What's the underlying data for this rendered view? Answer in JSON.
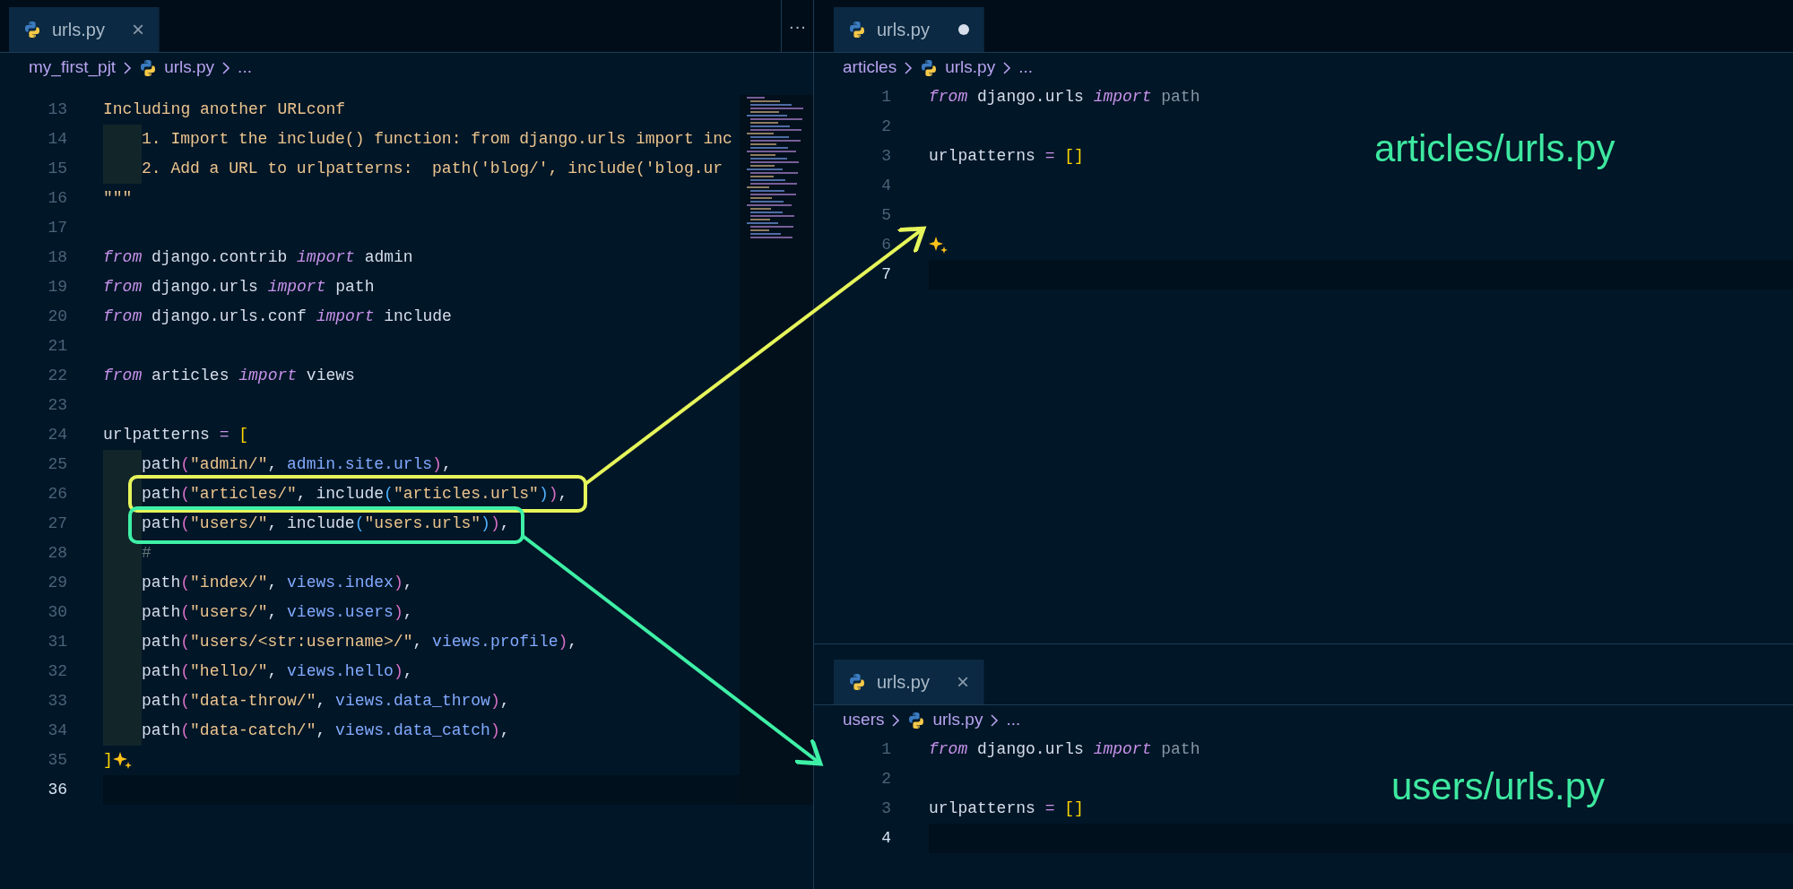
{
  "left_editor": {
    "tab": {
      "label": "urls.py",
      "close": "×",
      "modified": false,
      "selected": true
    },
    "more_button": "···",
    "breadcrumb": [
      "my_first_pjt",
      "urls.py",
      "..."
    ],
    "lines": [
      {
        "number": "13",
        "tokens": [
          {
            "kind": "docstring",
            "text": "Including another URLconf"
          }
        ]
      },
      {
        "number": "14",
        "indented": true,
        "tokens": [
          {
            "kind": "docstring",
            "text": "1. Import the include() function: from django.urls import inc"
          }
        ]
      },
      {
        "number": "15",
        "indented": true,
        "tokens": [
          {
            "kind": "docstring",
            "text": "2. Add a URL to urlpatterns:  path('blog/', include('blog.ur"
          }
        ]
      },
      {
        "number": "16",
        "tokens": [
          {
            "kind": "docstring",
            "text": "\"\"\""
          }
        ]
      },
      {
        "number": "17"
      },
      {
        "number": "18",
        "tokens": [
          {
            "kind": "keyword",
            "text": "from"
          },
          {
            "kind": "plain",
            "text": " django.contrib "
          },
          {
            "kind": "keyword",
            "text": "import"
          },
          {
            "kind": "plain",
            "text": " admin"
          }
        ]
      },
      {
        "number": "19",
        "tokens": [
          {
            "kind": "keyword",
            "text": "from"
          },
          {
            "kind": "plain",
            "text": " django.urls "
          },
          {
            "kind": "keyword",
            "text": "import"
          },
          {
            "kind": "plain",
            "text": " path"
          }
        ]
      },
      {
        "number": "20",
        "tokens": [
          {
            "kind": "keyword",
            "text": "from"
          },
          {
            "kind": "plain",
            "text": " django.urls.conf "
          },
          {
            "kind": "keyword",
            "text": "import"
          },
          {
            "kind": "plain",
            "text": " include"
          }
        ]
      },
      {
        "number": "21"
      },
      {
        "number": "22",
        "tokens": [
          {
            "kind": "keyword",
            "text": "from"
          },
          {
            "kind": "plain",
            "text": " articles "
          },
          {
            "kind": "keyword",
            "text": "import"
          },
          {
            "kind": "plain",
            "text": " views"
          }
        ]
      },
      {
        "number": "23"
      },
      {
        "number": "24",
        "tokens": [
          {
            "kind": "plain",
            "text": "urlpatterns "
          },
          {
            "kind": "operator",
            "text": "="
          },
          {
            "kind": "bracket",
            "text": " ["
          }
        ]
      },
      {
        "number": "25",
        "indented": true,
        "tokens": [
          {
            "kind": "plain",
            "text": "path"
          },
          {
            "kind": "paren",
            "text": "("
          },
          {
            "kind": "string",
            "text": "\"admin/\""
          },
          {
            "kind": "plain",
            "text": ", "
          },
          {
            "kind": "member",
            "text": "admin.site.urls"
          },
          {
            "kind": "paren",
            "text": ")"
          },
          {
            "kind": "plain",
            "text": ","
          }
        ]
      },
      {
        "number": "26",
        "indented": true,
        "tokens": [
          {
            "kind": "plain",
            "text": "path"
          },
          {
            "kind": "paren",
            "text": "("
          },
          {
            "kind": "string",
            "text": "\"articles/\""
          },
          {
            "kind": "plain",
            "text": ", include"
          },
          {
            "kind": "inner_paren",
            "text": "("
          },
          {
            "kind": "string",
            "text": "\"articles.urls\""
          },
          {
            "kind": "inner_paren",
            "text": ")"
          },
          {
            "kind": "paren",
            "text": ")"
          },
          {
            "kind": "plain",
            "text": ","
          }
        ]
      },
      {
        "number": "27",
        "indented": true,
        "tokens": [
          {
            "kind": "plain",
            "text": "path"
          },
          {
            "kind": "paren",
            "text": "("
          },
          {
            "kind": "string",
            "text": "\"users/\""
          },
          {
            "kind": "plain",
            "text": ", include"
          },
          {
            "kind": "inner_paren",
            "text": "("
          },
          {
            "kind": "string",
            "text": "\"users.urls\""
          },
          {
            "kind": "inner_paren",
            "text": ")"
          },
          {
            "kind": "paren",
            "text": ")"
          },
          {
            "kind": "plain",
            "text": ","
          }
        ]
      },
      {
        "number": "28",
        "indented": true,
        "tokens": [
          {
            "kind": "comment",
            "text": "#"
          }
        ]
      },
      {
        "number": "29",
        "indented": true,
        "tokens": [
          {
            "kind": "plain",
            "text": "path"
          },
          {
            "kind": "paren",
            "text": "("
          },
          {
            "kind": "string",
            "text": "\"index/\""
          },
          {
            "kind": "plain",
            "text": ", "
          },
          {
            "kind": "member",
            "text": "views.index"
          },
          {
            "kind": "paren",
            "text": ")"
          },
          {
            "kind": "plain",
            "text": ","
          }
        ]
      },
      {
        "number": "30",
        "indented": true,
        "tokens": [
          {
            "kind": "plain",
            "text": "path"
          },
          {
            "kind": "paren",
            "text": "("
          },
          {
            "kind": "string",
            "text": "\"users/\""
          },
          {
            "kind": "plain",
            "text": ", "
          },
          {
            "kind": "member",
            "text": "views.users"
          },
          {
            "kind": "paren",
            "text": ")"
          },
          {
            "kind": "plain",
            "text": ","
          }
        ]
      },
      {
        "number": "31",
        "indented": true,
        "tokens": [
          {
            "kind": "plain",
            "text": "path"
          },
          {
            "kind": "paren",
            "text": "("
          },
          {
            "kind": "string",
            "text": "\"users/<str:username>/\""
          },
          {
            "kind": "plain",
            "text": ", "
          },
          {
            "kind": "member",
            "text": "views.profile"
          },
          {
            "kind": "paren",
            "text": ")"
          },
          {
            "kind": "plain",
            "text": ","
          }
        ]
      },
      {
        "number": "32",
        "indented": true,
        "tokens": [
          {
            "kind": "plain",
            "text": "path"
          },
          {
            "kind": "paren",
            "text": "("
          },
          {
            "kind": "string",
            "text": "\"hello/\""
          },
          {
            "kind": "plain",
            "text": ", "
          },
          {
            "kind": "member",
            "text": "views.hello"
          },
          {
            "kind": "paren",
            "text": ")"
          },
          {
            "kind": "plain",
            "text": ","
          }
        ]
      },
      {
        "number": "33",
        "indented": true,
        "tokens": [
          {
            "kind": "plain",
            "text": "path"
          },
          {
            "kind": "paren",
            "text": "("
          },
          {
            "kind": "string",
            "text": "\"data-throw/\""
          },
          {
            "kind": "plain",
            "text": ", "
          },
          {
            "kind": "member",
            "text": "views.data_throw"
          },
          {
            "kind": "paren",
            "text": ")"
          },
          {
            "kind": "plain",
            "text": ","
          }
        ]
      },
      {
        "number": "34",
        "indented": true,
        "tokens": [
          {
            "kind": "plain",
            "text": "path"
          },
          {
            "kind": "paren",
            "text": "("
          },
          {
            "kind": "string",
            "text": "\"data-catch/\""
          },
          {
            "kind": "plain",
            "text": ", "
          },
          {
            "kind": "member",
            "text": "views.data_catch"
          },
          {
            "kind": "paren",
            "text": ")"
          },
          {
            "kind": "plain",
            "text": ","
          }
        ]
      },
      {
        "number": "35",
        "sparkle": true,
        "tokens": [
          {
            "kind": "bracket",
            "text": "]"
          }
        ]
      },
      {
        "number": "36",
        "current": true
      }
    ]
  },
  "right_top_editor": {
    "tab": {
      "label": "urls.py",
      "modified": true,
      "selected": true
    },
    "breadcrumb": [
      "articles",
      "urls.py",
      "..."
    ],
    "lines": [
      {
        "number": "1",
        "tokens": [
          {
            "kind": "keyword",
            "text": "from"
          },
          {
            "kind": "plain",
            "text": " django.urls "
          },
          {
            "kind": "keyword",
            "text": "import"
          },
          {
            "kind": "unused",
            "text": " path"
          }
        ]
      },
      {
        "number": "2"
      },
      {
        "number": "3",
        "tokens": [
          {
            "kind": "plain",
            "text": "urlpatterns "
          },
          {
            "kind": "operator",
            "text": "="
          },
          {
            "kind": "bracket",
            "text": " []"
          }
        ]
      },
      {
        "number": "4"
      },
      {
        "number": "5"
      },
      {
        "number": "6",
        "sparkle": true
      },
      {
        "number": "7",
        "current": true
      }
    ]
  },
  "right_bottom_editor": {
    "tab": {
      "label": "urls.py",
      "close": "×",
      "modified": false,
      "selected": true
    },
    "breadcrumb": [
      "users",
      "urls.py",
      "..."
    ],
    "lines": [
      {
        "number": "1",
        "tokens": [
          {
            "kind": "keyword",
            "text": "from"
          },
          {
            "kind": "plain",
            "text": " django.urls "
          },
          {
            "kind": "keyword",
            "text": "import"
          },
          {
            "kind": "unused",
            "text": " path"
          }
        ]
      },
      {
        "number": "2"
      },
      {
        "number": "3",
        "tokens": [
          {
            "kind": "plain",
            "text": "urlpatterns "
          },
          {
            "kind": "operator",
            "text": "="
          },
          {
            "kind": "bracket",
            "text": " []"
          }
        ]
      },
      {
        "number": "4",
        "current": true
      }
    ]
  },
  "annotations": [
    {
      "label": "articles/urls.py",
      "color": "#e6f55a"
    },
    {
      "label": "users/urls.py",
      "color": "#3ef0a6"
    }
  ]
}
